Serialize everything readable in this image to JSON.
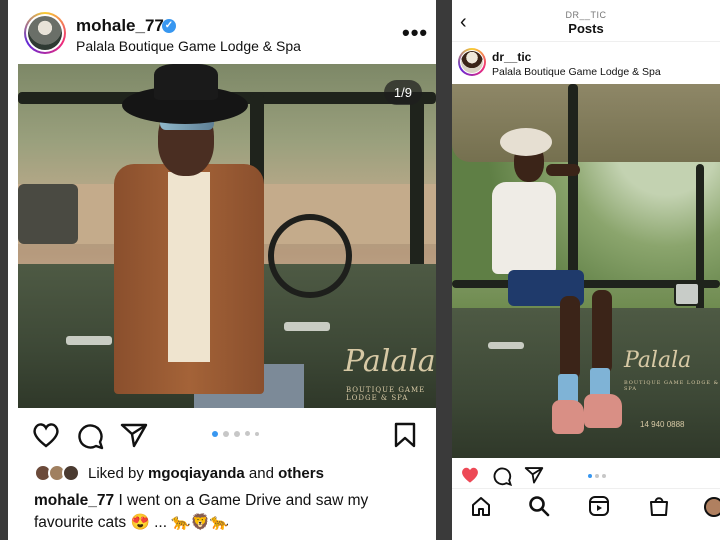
{
  "left_post": {
    "username": "mohale_77",
    "location": "Palala Boutique Game Lodge & Spa",
    "photo_counter": "1/9",
    "photo_logo_text": "Palala",
    "photo_logo_sub": "BOUTIQUE GAME LODGE & SPA",
    "carousel_dots": 5,
    "carousel_active_index": 0,
    "liked_prefix": "Liked by ",
    "liked_user": "mgoqiayanda",
    "liked_mid": " and ",
    "liked_others": "others",
    "caption_user": "mohale_77",
    "caption_text": " I went on a Game Drive and saw my favourite cats 😍 ... 🐆🦁🐆"
  },
  "right_post": {
    "header_sub": "DR__TIC",
    "header_title": "Posts",
    "username": "dr__tic",
    "location": "Palala Boutique Game Lodge & Spa",
    "photo_logo_text": "Palala",
    "photo_logo_sub": "BOUTIQUE GAME LODGE & SPA",
    "plate_text": "14 940 0888",
    "carousel_dots": 3,
    "carousel_active_index": 0
  },
  "colors": {
    "accent_blue": "#3897f0",
    "like_red": "#ed4956",
    "divider": "#3a3a3a"
  },
  "icons": {
    "left_actions": [
      "heart-icon",
      "comment-icon",
      "share-icon",
      "bookmark-icon"
    ],
    "right_actions": [
      "heart-filled-icon",
      "comment-icon",
      "share-icon"
    ],
    "bottom_nav": [
      "home-icon",
      "search-icon",
      "reels-icon",
      "shop-icon",
      "profile-icon"
    ]
  }
}
